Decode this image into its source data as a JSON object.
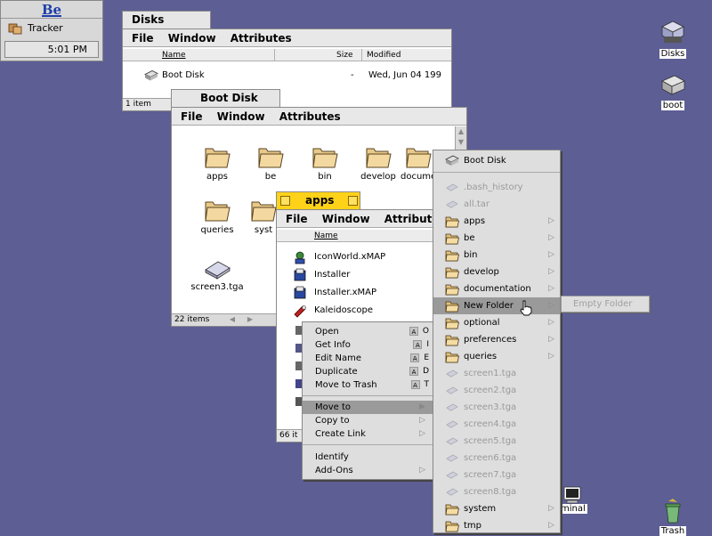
{
  "deskbar": {
    "logo": "Be",
    "tracker_label": "Tracker",
    "clock": "5:01 PM"
  },
  "desktop": {
    "disks_label": "Disks",
    "boot_label": "boot",
    "trash_label": "Trash",
    "terminal_partial": "minal"
  },
  "disks_window": {
    "title": "Disks",
    "menu": [
      "File",
      "Window",
      "Attributes"
    ],
    "columns": [
      "Name",
      "Size",
      "Modified"
    ],
    "rows": [
      {
        "name": "Boot Disk",
        "size": "-",
        "modified": "Wed, Jun 04 199"
      }
    ],
    "status": "1 item"
  },
  "bootdisk_window": {
    "title": "Boot Disk",
    "menu": [
      "File",
      "Window",
      "Attributes"
    ],
    "icons": [
      {
        "label": "apps",
        "icon": "folder-icon"
      },
      {
        "label": "be",
        "icon": "folder-icon"
      },
      {
        "label": "bin",
        "icon": "folder-icon"
      },
      {
        "label": "develop",
        "icon": "folder-icon"
      },
      {
        "label": "docume",
        "icon": "folder-icon"
      },
      {
        "label": "queries",
        "icon": "folder-icon"
      },
      {
        "label": "syst",
        "icon": "folder-icon"
      },
      {
        "label": "screen3.tga",
        "icon": "image-file-icon"
      }
    ],
    "status": "22 items"
  },
  "apps_window": {
    "title": "apps",
    "menu": [
      "File",
      "Window",
      "Attributes"
    ],
    "column": "Name",
    "rows": [
      {
        "name": "IconWorld.xMAP",
        "icon": "app-icon"
      },
      {
        "name": "Installer",
        "icon": "installer-icon"
      },
      {
        "name": "Installer.xMAP",
        "icon": "installer-icon"
      },
      {
        "name": "Kaleidoscope",
        "icon": "kaleidoscope-icon"
      }
    ],
    "status": "66 it"
  },
  "context_menu": {
    "group1": [
      {
        "label": "Open",
        "key": "O"
      },
      {
        "label": "Get Info",
        "key": "I"
      },
      {
        "label": "Edit Name",
        "key": "E"
      },
      {
        "label": "Duplicate",
        "key": "D"
      },
      {
        "label": "Move to Trash",
        "key": "T"
      }
    ],
    "group2": [
      "Move to",
      "Copy to",
      "Create Link"
    ],
    "group3": [
      "Identify",
      "Add-Ons"
    ],
    "modifier_key": "A",
    "highlighted": "Move to"
  },
  "navigator_menu": {
    "header": "Boot Disk",
    "items": [
      {
        "label": ".bash_history",
        "type": "file",
        "disabled": true
      },
      {
        "label": "all.tar",
        "type": "file",
        "disabled": true
      },
      {
        "label": "apps",
        "type": "folder"
      },
      {
        "label": "be",
        "type": "folder"
      },
      {
        "label": "bin",
        "type": "folder"
      },
      {
        "label": "develop",
        "type": "folder"
      },
      {
        "label": "documentation",
        "type": "folder"
      },
      {
        "label": "New Folder",
        "type": "folder",
        "highlighted": true
      },
      {
        "label": "optional",
        "type": "folder"
      },
      {
        "label": "preferences",
        "type": "folder"
      },
      {
        "label": "queries",
        "type": "folder"
      },
      {
        "label": "screen1.tga",
        "type": "file",
        "disabled": true
      },
      {
        "label": "screen2.tga",
        "type": "file",
        "disabled": true
      },
      {
        "label": "screen3.tga",
        "type": "file",
        "disabled": true
      },
      {
        "label": "screen4.tga",
        "type": "file",
        "disabled": true
      },
      {
        "label": "screen5.tga",
        "type": "file",
        "disabled": true
      },
      {
        "label": "screen6.tga",
        "type": "file",
        "disabled": true
      },
      {
        "label": "screen7.tga",
        "type": "file",
        "disabled": true
      },
      {
        "label": "screen8.tga",
        "type": "file",
        "disabled": true
      },
      {
        "label": "system",
        "type": "folder"
      },
      {
        "label": "tmp",
        "type": "folder"
      }
    ],
    "submenu_empty": "Empty Folder"
  },
  "colors": {
    "desktop": "#5d5e94",
    "active_tab": "#ffd21a",
    "highlight": "#9a9a9a"
  }
}
